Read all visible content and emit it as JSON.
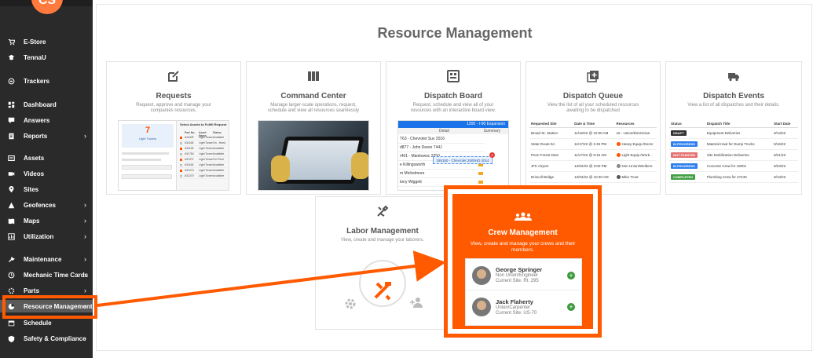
{
  "sidebar": {
    "avatar_initials": "CS",
    "items": [
      {
        "label": "E-Store",
        "icon": "cart-icon",
        "chevron": false,
        "active": false
      },
      {
        "label": "TennaU",
        "icon": "graduation-cap-icon",
        "chevron": false,
        "active": false
      },
      {
        "label": "Trackers",
        "icon": "tracker-icon",
        "chevron": false,
        "active": false
      },
      {
        "label": "Dashboard",
        "icon": "dashboard-icon",
        "chevron": false,
        "active": false
      },
      {
        "label": "Answers",
        "icon": "chat-icon",
        "chevron": false,
        "active": false
      },
      {
        "label": "Reports",
        "icon": "report-icon",
        "chevron": true,
        "active": false
      },
      {
        "label": "Assets",
        "icon": "assets-icon",
        "chevron": false,
        "active": false
      },
      {
        "label": "Videos",
        "icon": "video-icon",
        "chevron": false,
        "active": false
      },
      {
        "label": "Sites",
        "icon": "location-pin-icon",
        "chevron": false,
        "active": false
      },
      {
        "label": "Geofences",
        "icon": "geofence-icon",
        "chevron": true,
        "active": false
      },
      {
        "label": "Maps",
        "icon": "map-icon",
        "chevron": true,
        "active": false
      },
      {
        "label": "Utilization",
        "icon": "chart-icon",
        "chevron": true,
        "active": false
      },
      {
        "label": "Maintenance",
        "icon": "wrench-icon",
        "chevron": true,
        "active": false
      },
      {
        "label": "Mechanic Time Cards",
        "icon": "clock-icon",
        "chevron": true,
        "active": false
      },
      {
        "label": "Parts",
        "icon": "parts-icon",
        "chevron": true,
        "active": false
      },
      {
        "label": "Resource Management",
        "icon": "pie-chart-icon",
        "chevron": true,
        "active": true
      },
      {
        "label": "Schedule",
        "icon": "calendar-icon",
        "chevron": false,
        "active": false
      },
      {
        "label": "Safety & Compliance",
        "icon": "shield-icon",
        "chevron": true,
        "active": false
      }
    ]
  },
  "main": {
    "title": "Resource Management",
    "cards": {
      "requests": {
        "title": "Requests",
        "desc": "Request, approve and manage your companies resources.",
        "icon": "edit-icon",
        "preview": {
          "big_number": "7",
          "big_label": "Light Towers",
          "heading": "Select Assets to Fulfill Request",
          "cols": [
            "Part No.",
            "Asset Name",
            "Status"
          ],
          "rows": [
            [
              "#4434F",
              "Light Tower 1",
              "Available"
            ],
            [
              "#31168",
              "Light Tower 2",
              "On - Hand"
            ],
            [
              "#31198",
              "Light Tower 3",
              "Available"
            ],
            [
              "#31784",
              "Light Tower 4",
              "Available"
            ],
            [
              "#31371",
              "Light Tower 5",
              "For Rent"
            ],
            [
              "#31166",
              "Light Tower 6",
              "Available"
            ],
            [
              "#31374",
              "Light Tower 7",
              "Available"
            ],
            [
              "#31370",
              "Light Tower 8",
              "Available"
            ]
          ]
        }
      },
      "command_center": {
        "title": "Command Center",
        "desc": "Manage larger-scale operations, request, schedule and view all resources seamlessly",
        "icon": "columns-icon"
      },
      "dispatch_board": {
        "title": "Dispatch Board",
        "desc": "Request, schedule and view all of your resources with an interactive board view.",
        "icon": "board-icon",
        "preview": {
          "expansion": "1200 - I-90 Expansion",
          "detail_label": "Detail",
          "summary_label": "Summary",
          "rows": [
            "T63 - Chevrolet Suv 2016",
            "d877 - John Deere 744J",
            "r401 - Manitowoc 2250",
            "e Killingsworth",
            "m Michelmore",
            "tony Wiggett"
          ],
          "drag_label": "195150 - Chevrolet 2500HD 2014",
          "badge": "3"
        }
      },
      "dispatch_queue": {
        "title": "Dispatch Queue",
        "desc": "View the list of all your scheduled resources awaiting to be dispatched",
        "icon": "plus-square-icon",
        "preview": {
          "cols": [
            "Requested Site",
            "Date & Time",
            "Resources"
          ],
          "rows": [
            {
              "site": "Broad St. Station",
              "time": "11/16/22 @ 10:00 AM",
              "res": "15 - Union/Electrician",
              "dot": ""
            },
            {
              "site": "State Route 9A",
              "time": "11/17/22 @ 2:45 PM",
              "res": "Heavy Equip./Dozer",
              "dot": "#ff5500"
            },
            {
              "site": "Penn Forest Dam",
              "time": "11/17/22 @ 9:15 AM",
              "res": "Light Equip./Work...",
              "dot": "#ff5500"
            },
            {
              "site": "JFK Airport",
              "time": "12/02/22 @ 3:00 PM",
              "res": "Non Union/Welders",
              "dot": "#888888"
            },
            {
              "site": "Driscoll Bridge",
              "time": "12/04/22 @ 10:30 AM",
              "res": "Mike Trout",
              "dot": "#555555"
            }
          ]
        }
      },
      "dispatch_events": {
        "title": "Dispatch Events",
        "desc": "View a list of all dispatches and their details.",
        "icon": "truck-icon",
        "preview": {
          "cols": [
            "Status",
            "Dispatch Title",
            "Start Date"
          ],
          "rows": [
            {
              "status": "DRAFT",
              "color": "#333333",
              "title": "Equipment Deliveries",
              "date": "9/13/22"
            },
            {
              "status": "IN PROGRESS",
              "color": "#2f80ed",
              "title": "Material Haul for Dump Trucks",
              "date": "8/16/22"
            },
            {
              "status": "NOT STARTED",
              "color": "#e57373",
              "title": "Site Mobilization Deliveries",
              "date": "8/21/22"
            },
            {
              "status": "IN PROGRESS",
              "color": "#2f80ed",
              "title": "Concrete Crew for 18001",
              "date": "8/23/22"
            },
            {
              "status": "COMPLETED",
              "color": "#43a047",
              "title": "Plumbing Crew for 27440",
              "date": "9/13/22"
            }
          ]
        }
      },
      "labor_management": {
        "title": "Labor Management",
        "desc": "View, create and manage your laborers.",
        "icon": "tools-icon"
      },
      "crew_management": {
        "title": "Crew Management",
        "desc": "View, create and manage your crews and their members.",
        "icon": "group-icon",
        "members": [
          {
            "name": "George Springer",
            "role": "Non Union/Engineer",
            "site": "Current Site: Rt. 295"
          },
          {
            "name": "Jack Flaherty",
            "role": "Union/Carpenter",
            "site": "Current Site: US-70"
          }
        ]
      }
    }
  },
  "colors": {
    "accent": "#ff5a00",
    "sidebar_bg": "#2a2a2a",
    "success": "#3a9a3a"
  }
}
